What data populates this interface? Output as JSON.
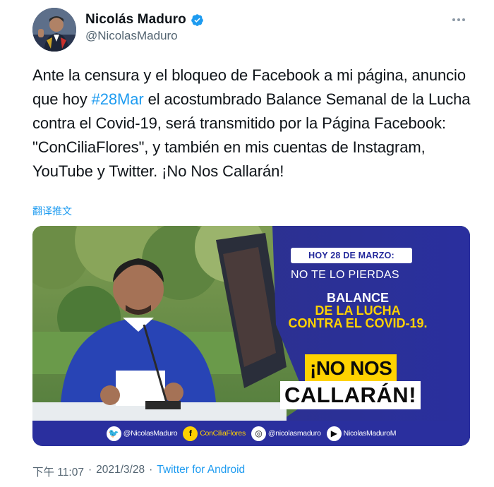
{
  "author": {
    "name": "Nicolás Maduro",
    "handle": "@NicolasMaduro",
    "verified": true
  },
  "tweet": {
    "text_part1": "Ante la censura y el bloqueo de Facebook a mi página, anuncio que hoy ",
    "hashtag": "#28Mar",
    "text_part2": " el acostumbrado Balance Semanal de la Lucha contra el Covid-19, será transmitido por la Página Facebook: \"ConCiliaFlores\", y también en mis cuentas de Instagram, YouTube y Twitter. ¡No Nos Callarán!",
    "translate_label": "翻译推文"
  },
  "media": {
    "date_pill": "HOY 28 DE MARZO:",
    "subtitle": "NO TE LO PIERDAS",
    "headline_1": "BALANCE",
    "headline_2": "DE LA LUCHA",
    "headline_3": "CONTRA EL COVID-19.",
    "slogan_1": "¡NO NOS",
    "slogan_2": "CALLARÁN!",
    "social": [
      {
        "icon": "twitter-icon",
        "label": "@NicolasMaduro"
      },
      {
        "icon": "facebook-icon",
        "label": "ConCiliaFlores"
      },
      {
        "icon": "instagram-icon",
        "label": "@nicolasmaduro"
      },
      {
        "icon": "youtube-icon",
        "label": "NicolasMaduroM"
      }
    ],
    "colors": {
      "banner_blue": "#2a2f9e",
      "accent_yellow": "#ffd200"
    }
  },
  "meta": {
    "time": "下午 11:07",
    "separator": "·",
    "date": "2021/3/28",
    "source": "Twitter for Android"
  },
  "colors": {
    "link": "#1d9bf0",
    "muted": "#536471",
    "text": "#0f1419"
  }
}
